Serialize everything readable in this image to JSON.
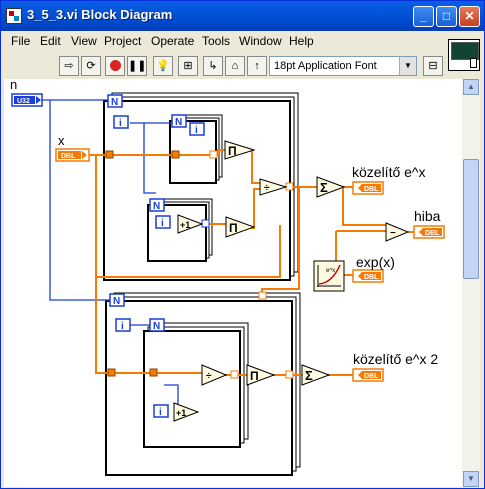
{
  "window": {
    "title": "3_5_3.vi Block Diagram",
    "minimize": "_",
    "maximize": "□",
    "close": "✕"
  },
  "menu": [
    "File",
    "Edit",
    "View",
    "Project",
    "Operate",
    "Tools",
    "Window",
    "Help"
  ],
  "toolbar": {
    "buttons": [
      "run-arrow-icon",
      "run-continuous-icon",
      "abort-icon",
      "pause-icon",
      "highlight-icon",
      "retain-wire-icon",
      "step-into-icon",
      "step-over-icon",
      "step-out-icon"
    ],
    "font": "18pt Application Font"
  },
  "diagram": {
    "labels": {
      "n": "n",
      "x": "x",
      "kozelito": "közelítő e^x",
      "hiba": "hiba",
      "exp": "exp(x)",
      "kozelito2": "közelítő e^x 2"
    },
    "terminals": {
      "u32": "U32",
      "dbl": "DBL"
    },
    "for_count": "N",
    "for_index": "i",
    "ops": {
      "product": "Π",
      "sum": "Σ",
      "divide": "÷",
      "increment": "+1",
      "subtract": "−"
    }
  },
  "colors": {
    "int_wire": "#1a3ed8",
    "dbl_wire": "#f47c06",
    "titlebar": "#0453d8"
  }
}
